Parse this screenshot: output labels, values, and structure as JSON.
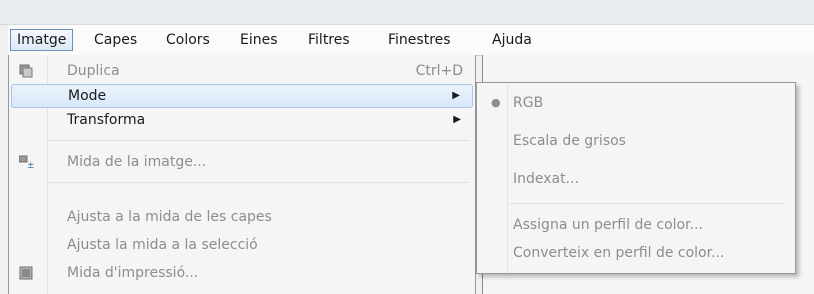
{
  "menubar": {
    "items": [
      {
        "label": "Imatge"
      },
      {
        "label": "Capes"
      },
      {
        "label": "Colors"
      },
      {
        "label": "Eines"
      },
      {
        "label": "Filtres"
      },
      {
        "label": "Finestres"
      },
      {
        "label": "Ajuda"
      }
    ]
  },
  "image_menu": {
    "items": [
      {
        "label": "Duplica",
        "shortcut": "Ctrl+D"
      },
      {
        "label": "Mode"
      },
      {
        "label": "Transforma"
      },
      {
        "label": "Mida de la imatge..."
      },
      {
        "label": "Ajusta a la mida de les capes"
      },
      {
        "label": "Ajusta la mida a la selecció"
      },
      {
        "label": "Mida d'impressió..."
      }
    ]
  },
  "mode_submenu": {
    "items": [
      {
        "label": "RGB",
        "bullet": "●"
      },
      {
        "label": "Escala de grisos"
      },
      {
        "label": "Indexat..."
      },
      {
        "label": "Assigna un perfil de color..."
      },
      {
        "label": "Converteix en perfil de color..."
      }
    ]
  },
  "glyphs": {
    "submenu_arrow": "▶"
  },
  "colors": {
    "highlight_border": "#a8c6e8",
    "highlight_fill": "#dbe9f8",
    "disabled_text": "#8d8d8d"
  }
}
